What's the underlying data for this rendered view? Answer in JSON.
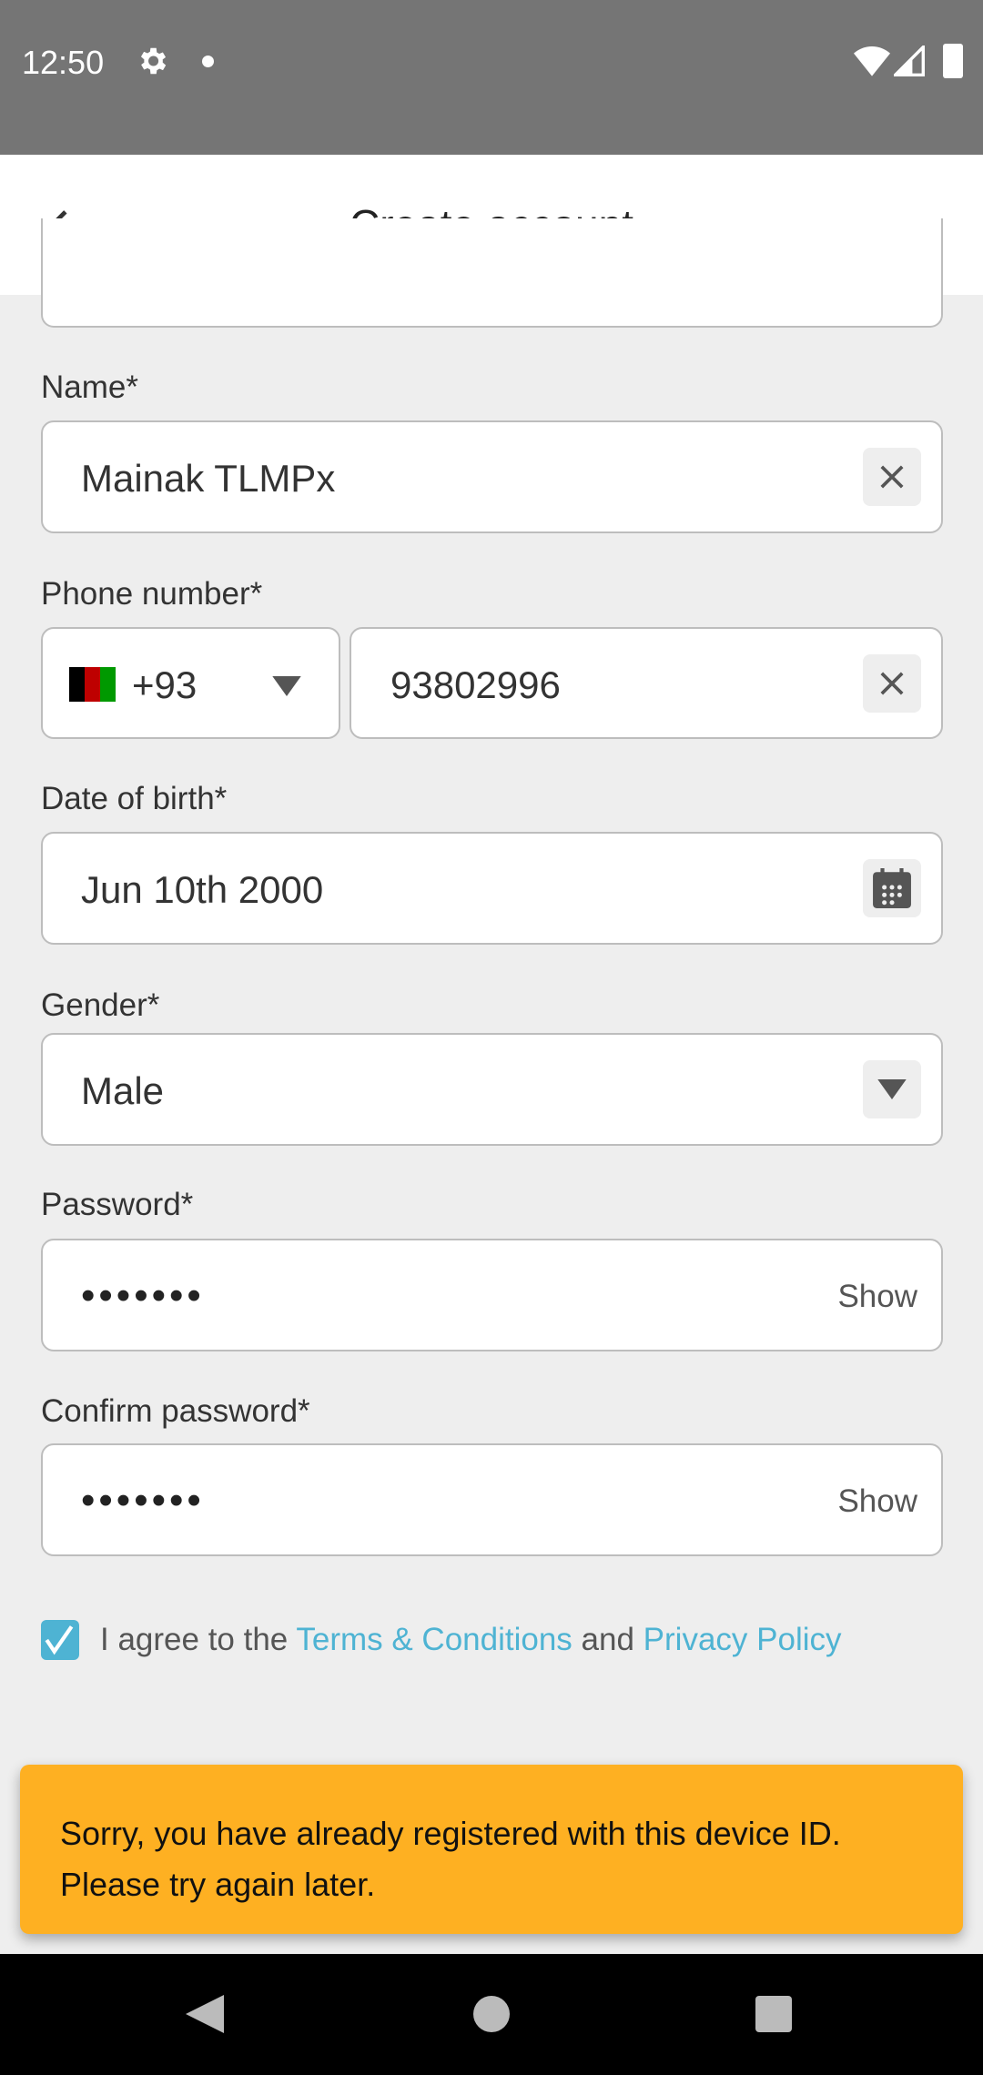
{
  "status_bar": {
    "time": "12:50",
    "icons": [
      "settings-icon",
      "dot-icon",
      "wifi-icon",
      "signal-icon",
      "battery-icon"
    ]
  },
  "app_bar": {
    "title": "Create account",
    "back_icon": "arrow-left-icon"
  },
  "form": {
    "name": {
      "label": "Name*",
      "value": "Mainak TLMPx"
    },
    "phone": {
      "label": "Phone number*",
      "country_code": "+93",
      "country": "Afghanistan",
      "number": "93802996"
    },
    "dob": {
      "label": "Date of birth*",
      "value": "Jun 10th 2000"
    },
    "gender": {
      "label": "Gender*",
      "value": "Male"
    },
    "password": {
      "label": "Password*",
      "value": "•••••••",
      "show": "Show"
    },
    "confirm_password": {
      "label": "Confirm password*",
      "value": "•••••••",
      "show": "Show"
    },
    "agree": {
      "checked": true,
      "prefix": "I agree to the ",
      "terms": "Terms & Conditions",
      "middle": " and ",
      "privacy": "Privacy Policy"
    }
  },
  "toast": {
    "line1": "Sorry, you have already registered with this device ID.",
    "line2": "Please try again later.",
    "color": "#feb022"
  },
  "colors": {
    "accent": "#4eb3d3"
  }
}
